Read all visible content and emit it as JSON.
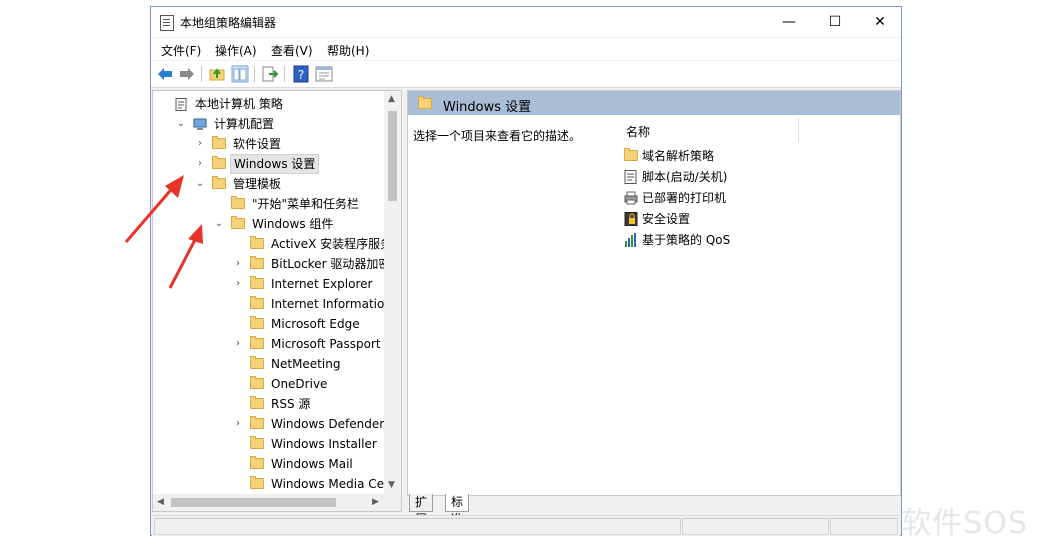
{
  "window": {
    "title": "本地组策略编辑器",
    "controls": {
      "minimize": "—",
      "maximize": "☐",
      "close": "✕"
    }
  },
  "menu": [
    "文件(F)",
    "操作(A)",
    "查看(V)",
    "帮助(H)"
  ],
  "toolbar": {
    "icons": [
      "back-arrow-icon",
      "forward-arrow-icon",
      "up-folder-icon",
      "show-hide-tree-icon",
      "export-list-icon",
      "help-icon",
      "properties-icon"
    ]
  },
  "tree": [
    {
      "label": "本地计算机 策略",
      "arrow": "",
      "icon": "policy",
      "indent": 0
    },
    {
      "label": "计算机配置",
      "arrow": "⌄",
      "icon": "computer",
      "indent": 1
    },
    {
      "label": "软件设置",
      "arrow": "›",
      "icon": "folder",
      "indent": 2
    },
    {
      "label": "Windows 设置",
      "arrow": "›",
      "icon": "folder",
      "indent": 2,
      "selected": true
    },
    {
      "label": "管理模板",
      "arrow": "⌄",
      "icon": "folder",
      "indent": 2
    },
    {
      "label": "\"开始\"菜单和任务栏",
      "arrow": "",
      "icon": "folder",
      "indent": 3
    },
    {
      "label": "Windows 组件",
      "arrow": "⌄",
      "icon": "folder",
      "indent": 3
    },
    {
      "label": "ActiveX 安装程序服务",
      "arrow": "",
      "icon": "folder",
      "indent": 4
    },
    {
      "label": "BitLocker 驱动器加密",
      "arrow": "›",
      "icon": "folder",
      "indent": 4
    },
    {
      "label": "Internet Explorer",
      "arrow": "›",
      "icon": "folder",
      "indent": 4
    },
    {
      "label": "Internet Information Se",
      "arrow": "",
      "icon": "folder",
      "indent": 4
    },
    {
      "label": "Microsoft Edge",
      "arrow": "",
      "icon": "folder",
      "indent": 4
    },
    {
      "label": "Microsoft Passport for",
      "arrow": "›",
      "icon": "folder",
      "indent": 4
    },
    {
      "label": "NetMeeting",
      "arrow": "",
      "icon": "folder",
      "indent": 4
    },
    {
      "label": "OneDrive",
      "arrow": "",
      "icon": "folder",
      "indent": 4
    },
    {
      "label": "RSS 源",
      "arrow": "",
      "icon": "folder",
      "indent": 4
    },
    {
      "label": "Windows Defender",
      "arrow": "›",
      "icon": "folder",
      "indent": 4
    },
    {
      "label": "Windows Installer",
      "arrow": "",
      "icon": "folder",
      "indent": 4
    },
    {
      "label": "Windows Mail",
      "arrow": "",
      "icon": "folder",
      "indent": 4
    },
    {
      "label": "Windows Media Cente",
      "arrow": "",
      "icon": "folder",
      "indent": 4
    }
  ],
  "right_pane": {
    "header_title": "Windows 设置",
    "description": "选择一个项目来查看它的描述。",
    "column_name": "名称",
    "items": [
      {
        "label": "域名解析策略",
        "icon": "folder-icon"
      },
      {
        "label": "脚本(启动/关机)",
        "icon": "script-icon"
      },
      {
        "label": "已部署的打印机",
        "icon": "printer-icon"
      },
      {
        "label": "安全设置",
        "icon": "security-icon"
      },
      {
        "label": "基于策略的 QoS",
        "icon": "qos-chart-icon"
      }
    ]
  },
  "tabs": [
    "扩展",
    "标准"
  ],
  "watermark": "软件SOS"
}
